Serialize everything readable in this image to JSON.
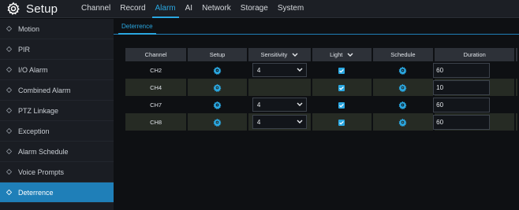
{
  "app": {
    "title": "Setup"
  },
  "top_nav": [
    "Channel",
    "Record",
    "Alarm",
    "AI",
    "Network",
    "Storage",
    "System"
  ],
  "top_nav_active": "Alarm",
  "sidebar": {
    "items": [
      {
        "label": "Motion"
      },
      {
        "label": "PIR"
      },
      {
        "label": "I/O Alarm"
      },
      {
        "label": "Combined Alarm"
      },
      {
        "label": "PTZ Linkage"
      },
      {
        "label": "Exception"
      },
      {
        "label": "Alarm Schedule"
      },
      {
        "label": "Voice Prompts"
      },
      {
        "label": "Deterrence"
      }
    ],
    "active": "Deterrence"
  },
  "subtab": {
    "label": "Deterrence"
  },
  "table": {
    "headers": {
      "channel": "Channel",
      "setup": "Setup",
      "sensitivity": "Sensitivity",
      "light": "Light",
      "schedule": "Schedule",
      "duration": "Duration"
    },
    "rows": [
      {
        "channel": "CH2",
        "sensitivity": "4",
        "light_checked": true,
        "duration": "60"
      },
      {
        "channel": "CH4",
        "sensitivity": "",
        "light_checked": true,
        "duration": "10"
      },
      {
        "channel": "CH7",
        "sensitivity": "4",
        "light_checked": true,
        "duration": "60"
      },
      {
        "channel": "CH8",
        "sensitivity": "4",
        "light_checked": true,
        "duration": "60"
      }
    ]
  },
  "colors": {
    "accent": "#2aa7e0",
    "active_bg": "#1f7fb8"
  },
  "icons": {
    "logo": "gear-icon",
    "setup": "gear-icon",
    "schedule": "gear-icon",
    "sidebar": "diamond-icon",
    "dropdown": "chevron-down-icon",
    "checkbox": "checkbox-checked-icon"
  }
}
